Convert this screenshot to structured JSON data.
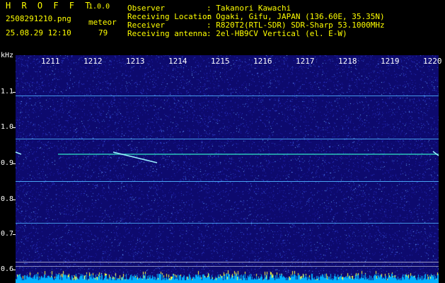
{
  "header": {
    "app_name": "H R O F F T",
    "version": "1.0.0",
    "filename": "2508291210.png",
    "datetime": "25.08.29 12:10",
    "meteor_label": "meteor",
    "meteor_count": "79",
    "info": [
      {
        "label": "Observer",
        "value": ": Takanori Kawachi"
      },
      {
        "label": "Receiving Location",
        "value": ": Ogaki, Gifu, JAPAN (136.60E, 35.35N)"
      },
      {
        "label": "Receiver",
        "value": ": R820T2(RTL-SDR) SDR-Sharp 53.1000MHz"
      },
      {
        "label": "Receiving antenna",
        "value": ": 2el-HB9CV Vertical (el. E-W)"
      }
    ]
  },
  "axis": {
    "y_unit": "kHz",
    "y_ticks": [
      "1.1",
      "1.0",
      "0.9",
      "0.8",
      "0.7",
      "0.6"
    ],
    "x_ticks": [
      "1211",
      "1212",
      "1213",
      "1214",
      "1215",
      "1216",
      "1217",
      "1218",
      "1219",
      "1220"
    ]
  },
  "colors": {
    "background": "#0d0a6e",
    "carrier": "#4fb4ff",
    "meteor": "#9af0ff",
    "header_text": "#ffff00",
    "bar": "#00b0ff"
  }
}
